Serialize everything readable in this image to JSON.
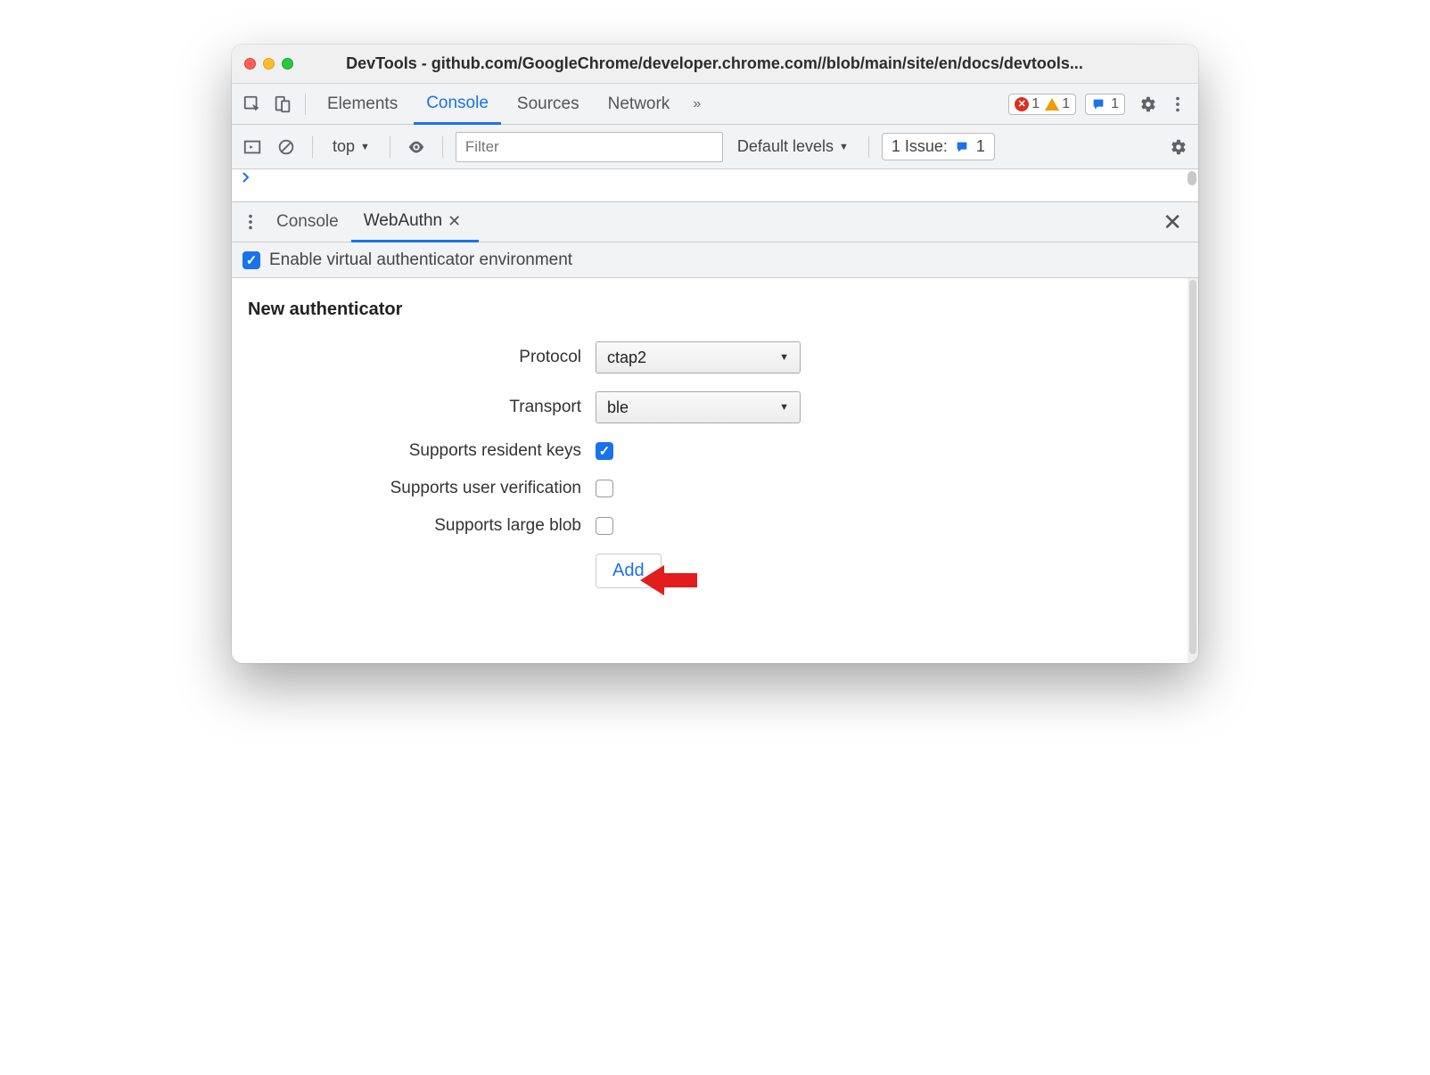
{
  "window": {
    "title": "DevTools - github.com/GoogleChrome/developer.chrome.com//blob/main/site/en/docs/devtools..."
  },
  "main_tabs": {
    "items": [
      "Elements",
      "Console",
      "Sources",
      "Network"
    ],
    "active": "Console",
    "overflow_glyph": "»"
  },
  "status_badges": {
    "errors": "1",
    "warnings": "1",
    "messages": "1"
  },
  "console_toolbar": {
    "context": "top",
    "filter_placeholder": "Filter",
    "level_label": "Default levels",
    "issues_label": "1 Issue:",
    "issues_count": "1"
  },
  "drawer_tabs": {
    "items": [
      "Console",
      "WebAuthn"
    ],
    "active": "WebAuthn"
  },
  "enable_checkbox": {
    "label": "Enable virtual authenticator environment",
    "checked": true
  },
  "form": {
    "title": "New authenticator",
    "protocol_label": "Protocol",
    "protocol_value": "ctap2",
    "transport_label": "Transport",
    "transport_value": "ble",
    "resident_keys_label": "Supports resident keys",
    "resident_keys_checked": true,
    "user_verification_label": "Supports user verification",
    "user_verification_checked": false,
    "large_blob_label": "Supports large blob",
    "large_blob_checked": false,
    "add_label": "Add"
  }
}
